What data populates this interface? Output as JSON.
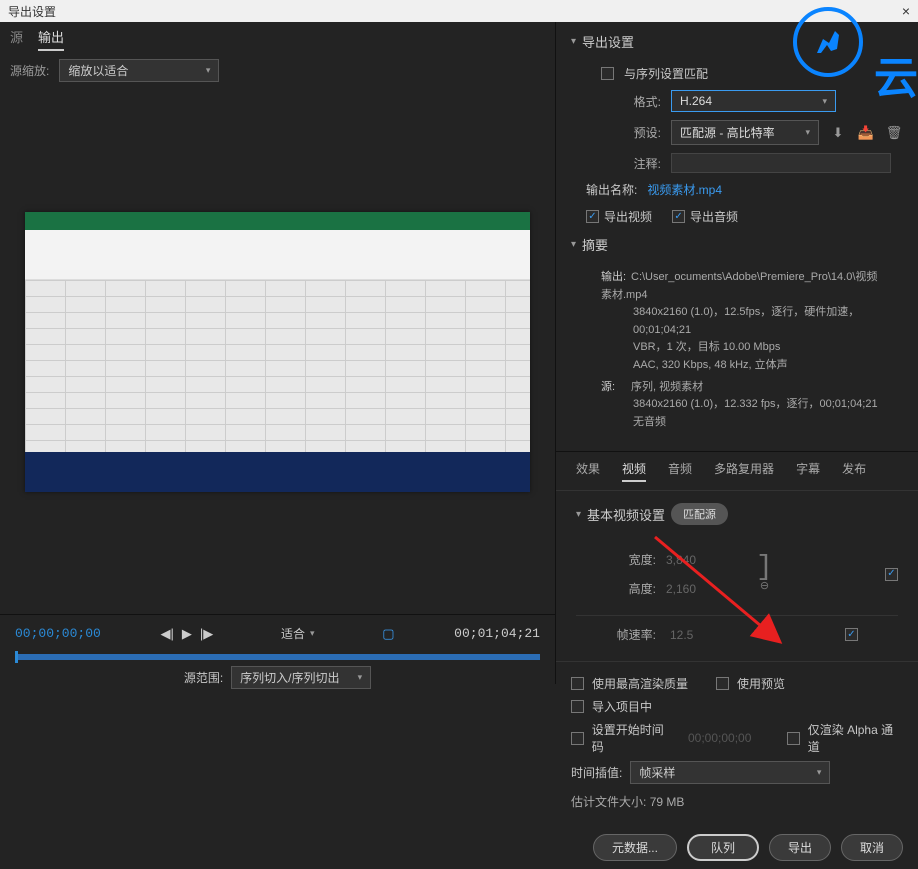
{
  "window": {
    "title": "导出设置"
  },
  "left": {
    "tabs": {
      "source": "源",
      "output": "输出"
    },
    "scale_label": "源缩放:",
    "scale_value": "缩放以适合",
    "timecode_in": "00;00;00;00",
    "timecode_out": "00;01;04;21",
    "fit_label": "适合",
    "source_range_label": "源范围:",
    "source_range_value": "序列切入/序列切出"
  },
  "export": {
    "header": "导出设置",
    "match_sequence": "与序列设置匹配",
    "format_label": "格式:",
    "format_value": "H.264",
    "preset_label": "预设:",
    "preset_value": "匹配源 - 高比特率",
    "comment_label": "注释:",
    "output_name_label": "输出名称:",
    "output_name_value": "视频素材.mp4",
    "export_video": "导出视频",
    "export_audio": "导出音频"
  },
  "summary": {
    "header": "摘要",
    "output_label": "输出:",
    "output_path": "C:\\User_ocuments\\Adobe\\Premiere_Pro\\14.0\\视频素材.mp4",
    "output_line2": "3840x2160 (1.0)，12.5fps，逐行，硬件加速，00;01;04;21",
    "output_line3": "VBR，1 次，目标 10.00 Mbps",
    "output_line4": "AAC, 320 Kbps, 48 kHz, 立体声",
    "source_label": "源:",
    "source_line1": "序列, 视频素材",
    "source_line2": "3840x2160 (1.0)，12.332 fps，逐行，00;01;04;21",
    "source_line3": "无音频"
  },
  "tabs": {
    "effects": "效果",
    "video": "视频",
    "audio": "音频",
    "mux": "多路复用器",
    "caption": "字幕",
    "publish": "发布"
  },
  "video": {
    "header": "基本视频设置",
    "match_source_btn": "匹配源",
    "width_label": "宽度:",
    "width_value": "3,840",
    "height_label": "高度:",
    "height_value": "2,160",
    "framerate_label": "帧速率:",
    "framerate_value": "12.5"
  },
  "bottom": {
    "max_quality": "使用最高渲染质量",
    "use_preview": "使用预览",
    "import_project": "导入项目中",
    "set_start_tc": "设置开始时间码",
    "start_tc_value": "00;00;00;00",
    "alpha_only": "仅渲染 Alpha 通道",
    "time_interp_label": "时间插值:",
    "time_interp_value": "帧采样",
    "est_size_label": "估计文件大小:",
    "est_size_value": "79 MB"
  },
  "buttons": {
    "metadata": "元数据...",
    "queue": "队列",
    "export": "导出",
    "cancel": "取消"
  },
  "logo": {
    "text": "云"
  }
}
